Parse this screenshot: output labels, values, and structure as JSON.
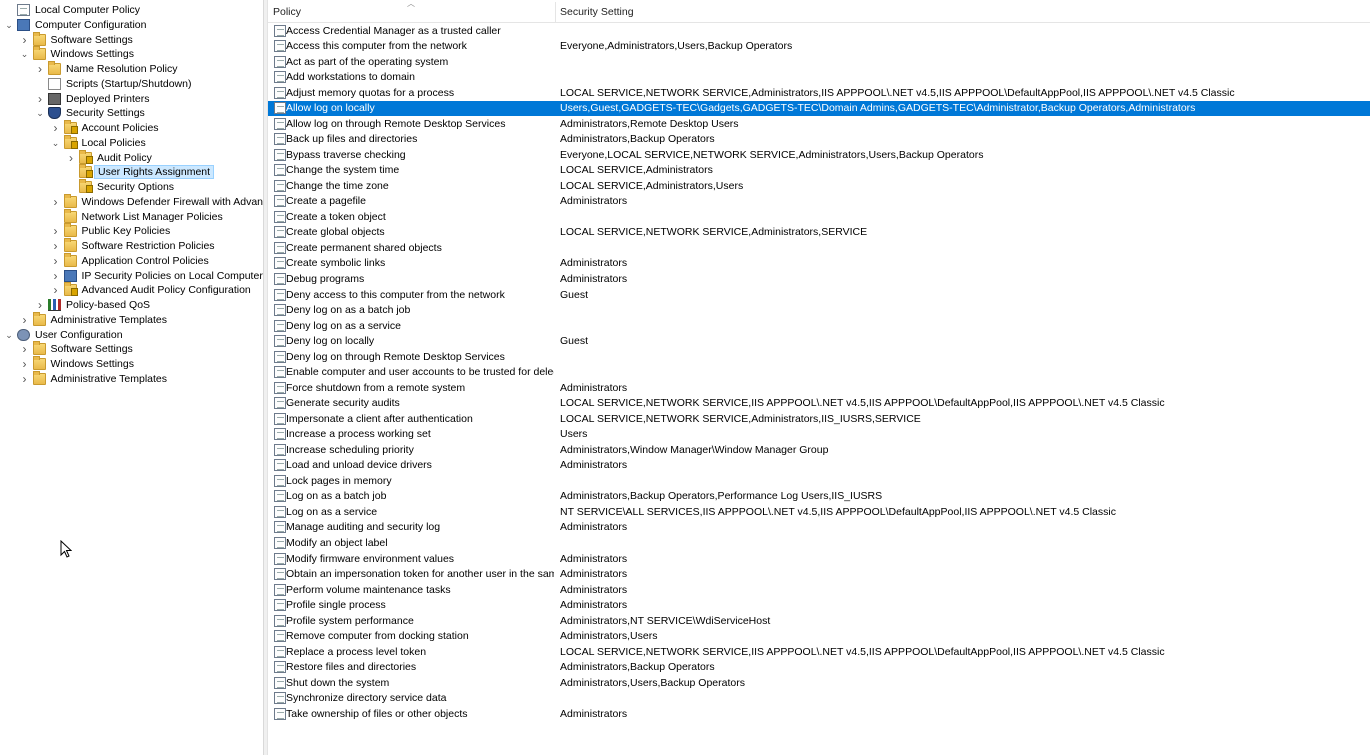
{
  "tree": [
    {
      "label": "Local Computer Policy",
      "icon": "policy-icon",
      "level": 0,
      "arrow": "none"
    },
    {
      "label": "Computer Configuration",
      "icon": "computer-icon",
      "level": 0,
      "arrow": "expanded"
    },
    {
      "label": "Software Settings",
      "icon": "folder-icon",
      "level": 1,
      "arrow": "collapsed"
    },
    {
      "label": "Windows Settings",
      "icon": "folder-icon",
      "level": 1,
      "arrow": "expanded"
    },
    {
      "label": "Name Resolution Policy",
      "icon": "folder-icon",
      "level": 2,
      "arrow": "collapsed"
    },
    {
      "label": "Scripts (Startup/Shutdown)",
      "icon": "script-icon",
      "level": 2,
      "arrow": "none"
    },
    {
      "label": "Deployed Printers",
      "icon": "printer-icon",
      "level": 2,
      "arrow": "collapsed"
    },
    {
      "label": "Security Settings",
      "icon": "shield-icon",
      "level": 2,
      "arrow": "expanded"
    },
    {
      "label": "Account Policies",
      "icon": "lock-folder-icon",
      "level": 3,
      "arrow": "collapsed"
    },
    {
      "label": "Local Policies",
      "icon": "lock-folder-icon",
      "level": 3,
      "arrow": "expanded"
    },
    {
      "label": "Audit Policy",
      "icon": "lock-folder-icon",
      "level": 4,
      "arrow": "collapsed"
    },
    {
      "label": "User Rights Assignment",
      "icon": "lock-folder-icon",
      "level": 4,
      "arrow": "none",
      "selected": true
    },
    {
      "label": "Security Options",
      "icon": "lock-folder-icon",
      "level": 4,
      "arrow": "none"
    },
    {
      "label": "Windows Defender Firewall with Advanced Security",
      "icon": "folder-icon",
      "level": 3,
      "arrow": "collapsed"
    },
    {
      "label": "Network List Manager Policies",
      "icon": "folder-icon",
      "level": 3,
      "arrow": "none"
    },
    {
      "label": "Public Key Policies",
      "icon": "folder-icon",
      "level": 3,
      "arrow": "collapsed"
    },
    {
      "label": "Software Restriction Policies",
      "icon": "folder-icon",
      "level": 3,
      "arrow": "collapsed"
    },
    {
      "label": "Application Control Policies",
      "icon": "folder-icon",
      "level": 3,
      "arrow": "collapsed"
    },
    {
      "label": "IP Security Policies on Local Computer",
      "icon": "computer-icon",
      "level": 3,
      "arrow": "collapsed"
    },
    {
      "label": "Advanced Audit Policy Configuration",
      "icon": "lock-folder-icon",
      "level": 3,
      "arrow": "collapsed"
    },
    {
      "label": "Policy-based QoS",
      "icon": "chart-icon",
      "level": 2,
      "arrow": "collapsed"
    },
    {
      "label": "Administrative Templates",
      "icon": "folder-icon",
      "level": 1,
      "arrow": "collapsed"
    },
    {
      "label": "User Configuration",
      "icon": "user-icon",
      "level": 0,
      "arrow": "expanded"
    },
    {
      "label": "Software Settings",
      "icon": "folder-icon",
      "level": 1,
      "arrow": "collapsed"
    },
    {
      "label": "Windows Settings",
      "icon": "folder-icon",
      "level": 1,
      "arrow": "collapsed"
    },
    {
      "label": "Administrative Templates",
      "icon": "folder-icon",
      "level": 1,
      "arrow": "collapsed"
    }
  ],
  "columns": {
    "policy": "Policy",
    "setting": "Security Setting"
  },
  "rows": [
    {
      "policy": "Access Credential Manager as a trusted caller",
      "setting": ""
    },
    {
      "policy": "Access this computer from the network",
      "setting": "Everyone,Administrators,Users,Backup Operators"
    },
    {
      "policy": "Act as part of the operating system",
      "setting": ""
    },
    {
      "policy": "Add workstations to domain",
      "setting": ""
    },
    {
      "policy": "Adjust memory quotas for a process",
      "setting": "LOCAL SERVICE,NETWORK SERVICE,Administrators,IIS APPPOOL\\.NET v4.5,IIS APPPOOL\\DefaultAppPool,IIS APPPOOL\\.NET v4.5 Classic"
    },
    {
      "policy": "Allow log on locally",
      "setting": "Users,Guest,GADGETS-TEC\\Gadgets,GADGETS-TEC\\Domain Admins,GADGETS-TEC\\Administrator,Backup Operators,Administrators",
      "selected": true
    },
    {
      "policy": "Allow log on through Remote Desktop Services",
      "setting": "Administrators,Remote Desktop Users"
    },
    {
      "policy": "Back up files and directories",
      "setting": "Administrators,Backup Operators"
    },
    {
      "policy": "Bypass traverse checking",
      "setting": "Everyone,LOCAL SERVICE,NETWORK SERVICE,Administrators,Users,Backup Operators"
    },
    {
      "policy": "Change the system time",
      "setting": "LOCAL SERVICE,Administrators"
    },
    {
      "policy": "Change the time zone",
      "setting": "LOCAL SERVICE,Administrators,Users"
    },
    {
      "policy": "Create a pagefile",
      "setting": "Administrators"
    },
    {
      "policy": "Create a token object",
      "setting": ""
    },
    {
      "policy": "Create global objects",
      "setting": "LOCAL SERVICE,NETWORK SERVICE,Administrators,SERVICE"
    },
    {
      "policy": "Create permanent shared objects",
      "setting": ""
    },
    {
      "policy": "Create symbolic links",
      "setting": "Administrators"
    },
    {
      "policy": "Debug programs",
      "setting": "Administrators"
    },
    {
      "policy": "Deny access to this computer from the network",
      "setting": "Guest"
    },
    {
      "policy": "Deny log on as a batch job",
      "setting": ""
    },
    {
      "policy": "Deny log on as a service",
      "setting": ""
    },
    {
      "policy": "Deny log on locally",
      "setting": "Guest"
    },
    {
      "policy": "Deny log on through Remote Desktop Services",
      "setting": ""
    },
    {
      "policy": "Enable computer and user accounts to be trusted for delega...",
      "setting": ""
    },
    {
      "policy": "Force shutdown from a remote system",
      "setting": "Administrators"
    },
    {
      "policy": "Generate security audits",
      "setting": "LOCAL SERVICE,NETWORK SERVICE,IIS APPPOOL\\.NET v4.5,IIS APPPOOL\\DefaultAppPool,IIS APPPOOL\\.NET v4.5 Classic"
    },
    {
      "policy": "Impersonate a client after authentication",
      "setting": "LOCAL SERVICE,NETWORK SERVICE,Administrators,IIS_IUSRS,SERVICE"
    },
    {
      "policy": "Increase a process working set",
      "setting": "Users"
    },
    {
      "policy": "Increase scheduling priority",
      "setting": "Administrators,Window Manager\\Window Manager Group"
    },
    {
      "policy": "Load and unload device drivers",
      "setting": "Administrators"
    },
    {
      "policy": "Lock pages in memory",
      "setting": ""
    },
    {
      "policy": "Log on as a batch job",
      "setting": "Administrators,Backup Operators,Performance Log Users,IIS_IUSRS"
    },
    {
      "policy": "Log on as a service",
      "setting": "NT SERVICE\\ALL SERVICES,IIS APPPOOL\\.NET v4.5,IIS APPPOOL\\DefaultAppPool,IIS APPPOOL\\.NET v4.5 Classic"
    },
    {
      "policy": "Manage auditing and security log",
      "setting": "Administrators"
    },
    {
      "policy": "Modify an object label",
      "setting": ""
    },
    {
      "policy": "Modify firmware environment values",
      "setting": "Administrators"
    },
    {
      "policy": "Obtain an impersonation token for another user in the same...",
      "setting": "Administrators"
    },
    {
      "policy": "Perform volume maintenance tasks",
      "setting": "Administrators"
    },
    {
      "policy": "Profile single process",
      "setting": "Administrators"
    },
    {
      "policy": "Profile system performance",
      "setting": "Administrators,NT SERVICE\\WdiServiceHost"
    },
    {
      "policy": "Remove computer from docking station",
      "setting": "Administrators,Users"
    },
    {
      "policy": "Replace a process level token",
      "setting": "LOCAL SERVICE,NETWORK SERVICE,IIS APPPOOL\\.NET v4.5,IIS APPPOOL\\DefaultAppPool,IIS APPPOOL\\.NET v4.5 Classic"
    },
    {
      "policy": "Restore files and directories",
      "setting": "Administrators,Backup Operators"
    },
    {
      "policy": "Shut down the system",
      "setting": "Administrators,Users,Backup Operators"
    },
    {
      "policy": "Synchronize directory service data",
      "setting": ""
    },
    {
      "policy": "Take ownership of files or other objects",
      "setting": "Administrators"
    }
  ],
  "colors": {
    "selection": "#0078d7",
    "tree_selection": "#cce8ff"
  }
}
